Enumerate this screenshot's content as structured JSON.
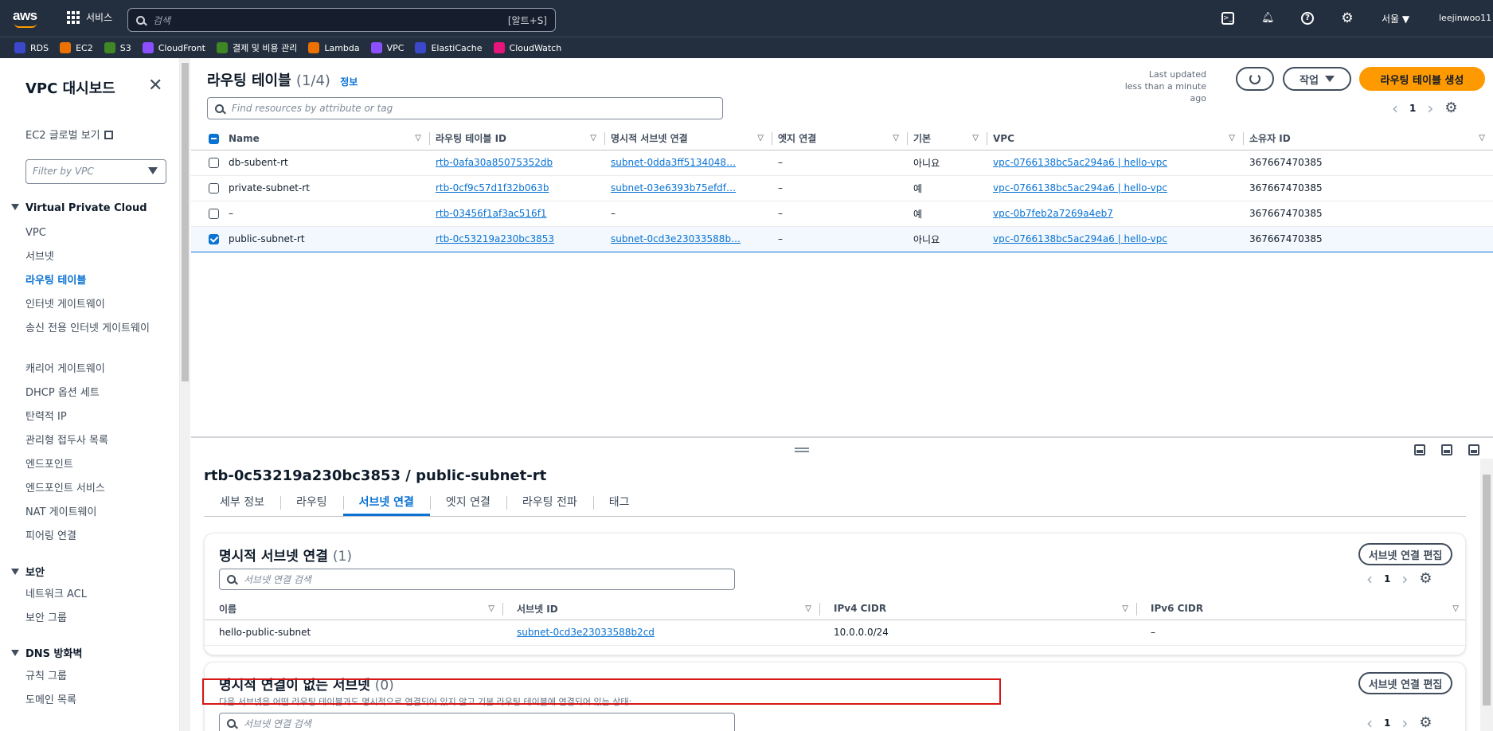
{
  "topnav": {
    "logo": "aws",
    "services_label": "서비스",
    "search_placeholder": "검색",
    "search_shortcut": "[알트+S]",
    "region": "서울 ▼",
    "user": "leejinwoo11"
  },
  "favorites": [
    {
      "label": "RDS",
      "color": "#3b48cc"
    },
    {
      "label": "EC2",
      "color": "#ed7100"
    },
    {
      "label": "S3",
      "color": "#3f8624"
    },
    {
      "label": "CloudFront",
      "color": "#8c4fff"
    },
    {
      "label": "결제 및 비용 관리",
      "color": "#3f8624"
    },
    {
      "label": "Lambda",
      "color": "#ed7100"
    },
    {
      "label": "VPC",
      "color": "#8c4fff"
    },
    {
      "label": "ElastiCache",
      "color": "#3b48cc"
    },
    {
      "label": "CloudWatch",
      "color": "#e7157b"
    }
  ],
  "sidebar": {
    "title": "VPC 대시보드",
    "global_link": "EC2 글로벌 보기",
    "filter_placeholder": "Filter by VPC",
    "section_vpc": "Virtual Private Cloud",
    "vpc_items": [
      "VPC",
      "서브넷",
      "라우팅 테이블",
      "인터넷 게이트웨이",
      "송신 전용 인터넷 게이트웨이",
      "캐리어 게이트웨이",
      "DHCP 옵션 세트",
      "탄력적 IP",
      "관리형 접두사 목록",
      "엔드포인트",
      "엔드포인트 서비스",
      "NAT 게이트웨이",
      "피어링 연결"
    ],
    "section_security": "보안",
    "security_items": [
      "네트워크 ACL",
      "보안 그룹"
    ],
    "section_dns": "DNS 방화벽",
    "dns_items": [
      "규칙 그룹",
      "도메인 목록"
    ]
  },
  "header": {
    "title": "라우팅 테이블",
    "count": "(1/4)",
    "info": "정보",
    "last_updated_1": "Last updated",
    "last_updated_2": "less than a minute ago",
    "actions_label": "작업",
    "create_label": "라우팅 테이블 생성",
    "find_placeholder": "Find resources by attribute or tag",
    "page": "1"
  },
  "route_table": {
    "columns": [
      "Name",
      "라우팅 테이블 ID",
      "명시적 서브넷 연결",
      "엣지 연결",
      "기본",
      "VPC",
      "소유자 ID"
    ],
    "rows": [
      {
        "name": "db-subent-rt",
        "id": "rtb-0afa30a85075352db",
        "subnet": "subnet-0dda3ff5134048…",
        "edge": "–",
        "main": "아니요",
        "vpc": "vpc-0766138bc5ac294a6 | hello-vpc",
        "owner": "367667470385",
        "selected": false
      },
      {
        "name": "private-subnet-rt",
        "id": "rtb-0cf9c57d1f32b063b",
        "subnet": "subnet-03e6393b75efdf…",
        "edge": "–",
        "main": "예",
        "vpc": "vpc-0766138bc5ac294a6 | hello-vpc",
        "owner": "367667470385",
        "selected": false
      },
      {
        "name": "–",
        "id": "rtb-03456f1af3ac516f1",
        "subnet": "–",
        "edge": "–",
        "main": "예",
        "vpc": "vpc-0b7feb2a7269a4eb7",
        "owner": "367667470385",
        "selected": false
      },
      {
        "name": "public-subnet-rt",
        "id": "rtb-0c53219a230bc3853",
        "subnet": "subnet-0cd3e23033588b…",
        "edge": "–",
        "main": "아니요",
        "vpc": "vpc-0766138bc5ac294a6 | hello-vpc",
        "owner": "367667470385",
        "selected": true
      }
    ]
  },
  "detail": {
    "title": "rtb-0c53219a230bc3853 / public-subnet-rt",
    "tabs": [
      "세부 정보",
      "라우팅",
      "서브넷 연결",
      "엣지 연결",
      "라우팅 전파",
      "태그"
    ],
    "active_tab": "서브넷 연결",
    "explicit": {
      "title": "명시적 서브넷 연결",
      "count": "(1)",
      "edit_label": "서브넷 연결 편집",
      "search_placeholder": "서브넷 연결 검색",
      "page": "1",
      "columns": [
        "이름",
        "서브넷 ID",
        "IPv4 CIDR",
        "IPv6 CIDR"
      ],
      "rows": [
        {
          "name": "hello-public-subnet",
          "subnet_id": "subnet-0cd3e23033588b2cd",
          "ipv4": "10.0.0.0/24",
          "ipv6": "–"
        }
      ]
    },
    "implicit": {
      "title": "명시적 연결이 없는 서브넷",
      "count": "(0)",
      "description": "다음 서브넷은 어떤 라우팅 테이블과도 명시적으로 연결되어 있지 않고 기본 라우팅 테이블에 연결되어 있는 상태:",
      "edit_label": "서브넷 연결 편집",
      "search_placeholder": "서브넷 연결 검색",
      "page": "1"
    }
  }
}
